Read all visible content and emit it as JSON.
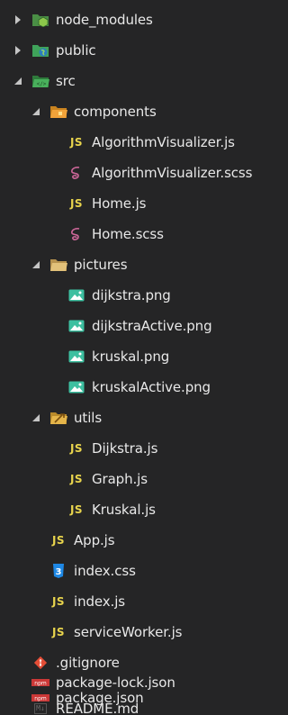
{
  "explorer": {
    "items": [
      {
        "label": "node_modules",
        "type": "folder",
        "expanded": false,
        "icon": "node-modules-folder-icon",
        "depth": 0
      },
      {
        "label": "public",
        "type": "folder",
        "expanded": false,
        "icon": "public-folder-icon",
        "depth": 0
      },
      {
        "label": "src",
        "type": "folder",
        "expanded": true,
        "icon": "src-folder-icon",
        "depth": 0
      },
      {
        "label": "components",
        "type": "folder",
        "expanded": true,
        "icon": "components-folder-icon",
        "depth": 1
      },
      {
        "label": "AlgorithmVisualizer.js",
        "type": "file",
        "icon": "javascript-file-icon",
        "depth": 2
      },
      {
        "label": "AlgorithmVisualizer.scss",
        "type": "file",
        "icon": "sass-file-icon",
        "depth": 2
      },
      {
        "label": "Home.js",
        "type": "file",
        "icon": "javascript-file-icon",
        "depth": 2
      },
      {
        "label": "Home.scss",
        "type": "file",
        "icon": "sass-file-icon",
        "depth": 2
      },
      {
        "label": "pictures",
        "type": "folder",
        "expanded": true,
        "icon": "pictures-folder-icon",
        "depth": 1
      },
      {
        "label": "dijkstra.png",
        "type": "file",
        "icon": "image-file-icon",
        "depth": 2
      },
      {
        "label": "dijkstraActive.png",
        "type": "file",
        "icon": "image-file-icon",
        "depth": 2
      },
      {
        "label": "kruskal.png",
        "type": "file",
        "icon": "image-file-icon",
        "depth": 2
      },
      {
        "label": "kruskalActive.png",
        "type": "file",
        "icon": "image-file-icon",
        "depth": 2
      },
      {
        "label": "utils",
        "type": "folder",
        "expanded": true,
        "icon": "utils-folder-icon",
        "depth": 1
      },
      {
        "label": "Dijkstra.js",
        "type": "file",
        "icon": "javascript-file-icon",
        "depth": 2
      },
      {
        "label": "Graph.js",
        "type": "file",
        "icon": "javascript-file-icon",
        "depth": 2
      },
      {
        "label": "Kruskal.js",
        "type": "file",
        "icon": "javascript-file-icon",
        "depth": 2
      },
      {
        "label": "App.js",
        "type": "file",
        "icon": "javascript-file-icon",
        "depth": 1
      },
      {
        "label": "index.css",
        "type": "file",
        "icon": "css-file-icon",
        "depth": 1
      },
      {
        "label": "index.js",
        "type": "file",
        "icon": "javascript-file-icon",
        "depth": 1
      },
      {
        "label": "serviceWorker.js",
        "type": "file",
        "icon": "javascript-file-icon",
        "depth": 1
      },
      {
        "label": ".gitignore",
        "type": "file",
        "icon": "git-file-icon",
        "depth": 0
      },
      {
        "label": "package-lock.json",
        "type": "file",
        "icon": "npm-file-icon",
        "depth": 0
      },
      {
        "label": "package.json",
        "type": "file",
        "icon": "npm-file-icon",
        "depth": 0
      },
      {
        "label": "README.md",
        "type": "file",
        "icon": "markdown-file-icon",
        "depth": 0
      }
    ]
  },
  "glyphs": {
    "js": "JS",
    "md": "M↓"
  },
  "colors": {
    "background": "#252526",
    "text": "#e8e8e8",
    "twisty": "#c5c5c5",
    "js": "#e8d44d",
    "sass": "#cd6799",
    "image": "#3dbfa0",
    "css": "#1e88e5",
    "git": "#e44d36",
    "npm": "#cb3837",
    "folder_green": "#3fa35a",
    "folder_orange": "#f2a33a",
    "folder_tan": "#d9b56c"
  }
}
